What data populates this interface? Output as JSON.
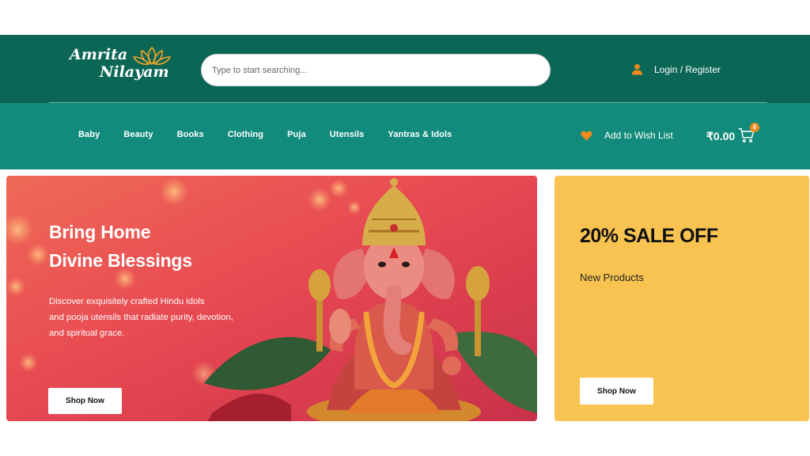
{
  "header": {
    "logo": {
      "line1": "Amrita",
      "line2": "Nilayam"
    },
    "search": {
      "placeholder": "Type to start searching..."
    },
    "account": {
      "label": "Login / Register",
      "icon": "user-icon"
    }
  },
  "nav": {
    "items": [
      {
        "label": "Baby"
      },
      {
        "label": "Beauty"
      },
      {
        "label": "Books"
      },
      {
        "label": "Clothing"
      },
      {
        "label": "Puja"
      },
      {
        "label": "Utensils"
      },
      {
        "label": "Yantras & Idols"
      }
    ],
    "wishlist": {
      "label": "Add to Wish List",
      "icon": "heart-icon"
    },
    "cart": {
      "total": "₹0.00",
      "count": "0",
      "icon": "cart-icon"
    }
  },
  "hero": {
    "title_line1": "Bring Home",
    "title_line2": "Divine Blessings",
    "desc_line1": "Discover exquisitely crafted Hindu idols",
    "desc_line2": "and pooja utensils that radiate purity, devotion,",
    "desc_line3": "and spiritual grace.",
    "button": "Shop Now"
  },
  "promo": {
    "title": "20% SALE OFF",
    "subtitle": "New Products",
    "button": "Shop Now"
  },
  "colors": {
    "header_dark": "#0b6656",
    "nav_teal": "#138b7c",
    "accent_orange": "#f08a1c",
    "promo_yellow": "#f9c351"
  }
}
